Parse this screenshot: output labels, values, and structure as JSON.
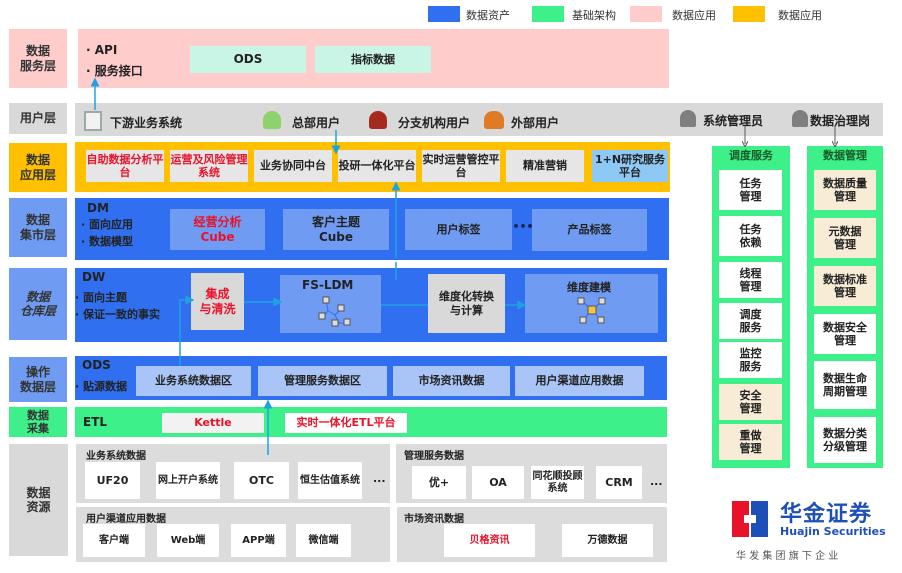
{
  "legend": [
    {
      "label": "数据资产",
      "color": "#2f6ff0"
    },
    {
      "label": "基础架构",
      "color": "#3df08a"
    },
    {
      "label": "数据应用",
      "color": "#ffcccc"
    },
    {
      "label": "数据应用",
      "color": "#ffc000"
    }
  ],
  "service": {
    "label": "数据\n服务层",
    "bullets": [
      "· API",
      "· 服务接口"
    ],
    "boxes": [
      "ODS",
      "指标数据"
    ]
  },
  "user": {
    "label": "用户层",
    "downstream": "下游业务系统",
    "hq": "总部用户",
    "branch": "分支机构用户",
    "external": "外部用户",
    "sysadmin": "系统管理员",
    "governance": "数据治理岗"
  },
  "app": {
    "label": "数据\n应用层",
    "items": [
      "自助数据分析平台",
      "运营及风险管理系统",
      "业务协同中台",
      "投研一体化平台",
      "实时运营管控平台",
      "精准营销",
      "1+N研究服务平台"
    ]
  },
  "dm": {
    "label": "数据\n集市层",
    "title": "DM",
    "bullets": [
      "· 面向应用",
      "· 数据模型"
    ],
    "boxes": [
      "经营分析\nCube",
      "客户主题\nCube",
      "用户标签",
      "产品标签"
    ],
    "ellipsis": "•••"
  },
  "dw": {
    "label": "数据\n仓库层",
    "title": "DW",
    "bullets": [
      "· 面向主题",
      "· 保证一致的事实"
    ],
    "clean": "集成\n与清洗",
    "fsldm": "FS-LDM",
    "dimconv": "维度化转换\n与计算",
    "dimmodel": "维度建模"
  },
  "ods": {
    "label": "操作\n数据层",
    "title": "ODS",
    "bullet": "· 贴源数据",
    "boxes": [
      "业务系统数据区",
      "管理服务数据区",
      "市场资讯数据",
      "用户渠道应用数据"
    ]
  },
  "etl": {
    "label": "数据\n采集",
    "title": "ETL",
    "boxes": [
      "Kettle",
      "实时一体化ETL平台"
    ]
  },
  "sources": {
    "label": "数据\n资源",
    "groups": [
      {
        "title": "业务系统数据",
        "items": [
          "UF20",
          "网上开户系统",
          "OTC",
          "恒生估值系统"
        ],
        "more": "..."
      },
      {
        "title": "管理服务数据",
        "items": [
          "优+",
          "OA",
          "同花顺投顾系统",
          "CRM"
        ],
        "more": "..."
      },
      {
        "title": "用户渠道应用数据",
        "items": [
          "客户端",
          "Web端",
          "APP端",
          "微信端"
        ]
      },
      {
        "title": "市场资讯数据",
        "items": [
          "贝格资讯",
          "万德数据"
        ]
      }
    ]
  },
  "schedule": {
    "title": "调度服务",
    "items": [
      "任务\n管理",
      "任务\n依赖",
      "线程\n管理",
      "调度\n服务",
      "监控\n服务",
      "安全\n管理",
      "重做\n管理"
    ]
  },
  "datamgmt": {
    "title": "数据管理",
    "items": [
      "数据质量\n管理",
      "元数据\n管理",
      "数据标准\n管理",
      "数据安全\n管理",
      "数据生命\n周期管理",
      "数据分类\n分级管理"
    ]
  },
  "logo": {
    "cn": "华金证券",
    "en": "Huajin Securities",
    "sub": "华 发 集 团 旗 下 企 业"
  }
}
